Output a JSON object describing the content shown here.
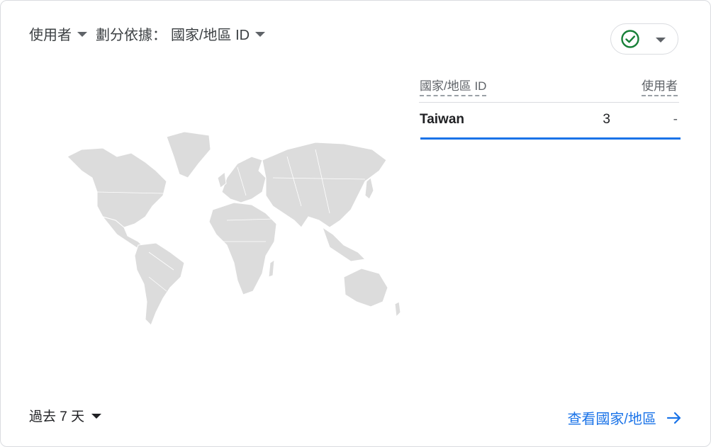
{
  "header": {
    "metric_label": "使用者",
    "segment_prefix": "劃分依據：",
    "segment_label": "國家/地區 ID"
  },
  "status": {
    "icon": "check-circle-icon",
    "color": "#188038"
  },
  "table": {
    "columns": [
      "國家/地區 ID",
      "使用者"
    ],
    "rows": [
      {
        "country": "Taiwan",
        "users": "3",
        "change": "-",
        "share": 1.0
      }
    ]
  },
  "footer": {
    "date_range": "過去 7 天",
    "view_link": "查看國家/地區"
  },
  "colors": {
    "accent": "#1a73e8",
    "map_land": "#dcdcdc"
  }
}
